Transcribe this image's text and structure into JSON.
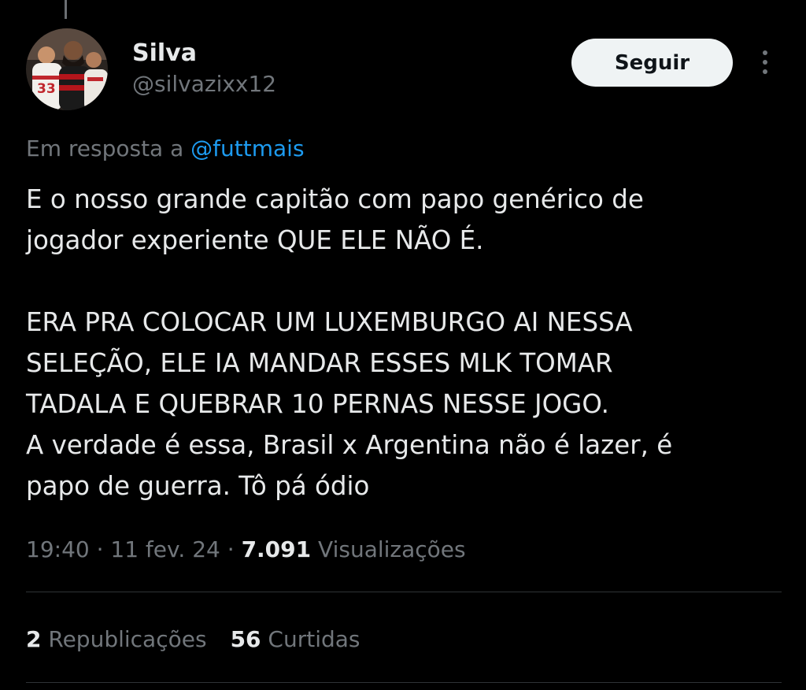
{
  "colors": {
    "background": "#000000",
    "text_primary": "#e7e9ea",
    "text_secondary": "#71767b",
    "link": "#1d9bf0",
    "follow_button_bg": "#eff3f4",
    "divider": "#2f3336"
  },
  "author": {
    "display_name": "Silva",
    "handle": "@silvazixx12",
    "avatar_icon": "profile-photo-football-players"
  },
  "actions": {
    "follow_label": "Seguir",
    "more_icon": "more-vertical-icon"
  },
  "reply": {
    "prefix": "Em resposta a ",
    "mention": "@futtmais"
  },
  "tweet": {
    "text": "E o nosso grande capitão com papo genérico de\njogador experiente QUE ELE NÃO É.\n\nERA PRA COLOCAR UM LUXEMBURGO AI NESSA\nSELEÇÃO, ELE IA MANDAR ESSES MLK TOMAR\nTADALA E QUEBRAR 10 PERNAS NESSE JOGO.\nA verdade é essa, Brasil x Argentina não é lazer, é\npapo de guerra. Tô pá ódio"
  },
  "meta": {
    "time": "19:40",
    "separator": " · ",
    "date": "11 fev. 24",
    "views_count": "7.091",
    "views_label": " Visualizações"
  },
  "stats": {
    "reposts_count": "2",
    "reposts_label": " Republicações",
    "likes_count": "56",
    "likes_label": " Curtidas"
  }
}
